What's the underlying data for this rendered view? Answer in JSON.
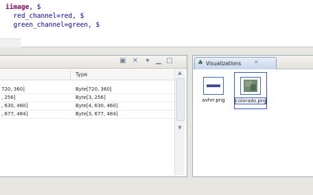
{
  "editor": {
    "lines": [
      {
        "kw": "iimage",
        "rest": ", $"
      },
      {
        "kw": "",
        "rest": "  red_channel=red, $"
      },
      {
        "kw": "",
        "rest": "  green_channel=green, $"
      }
    ]
  },
  "variables": {
    "columns": [
      "",
      "Type"
    ],
    "rows": [
      {
        "value": "720, 360]",
        "type": "Byte[720, 360]"
      },
      {
        "value": ", 256]",
        "type": "Byte[3, 256]"
      },
      {
        "value": ", 630, 460]",
        "type": "Byte[4, 630, 460]"
      },
      {
        "value": ", 677, 484]",
        "type": "Byte[3, 677, 484]"
      }
    ]
  },
  "visualizations": {
    "tab_label": "Visualizations",
    "items": [
      {
        "label": "avhrr.png"
      },
      {
        "label": "colorado.png"
      }
    ]
  }
}
